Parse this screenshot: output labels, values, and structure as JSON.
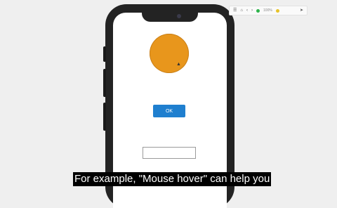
{
  "app": {
    "ok_button_label": "OK",
    "text_input_value": "",
    "text_input_placeholder": ""
  },
  "colors": {
    "circle": "#e8961c",
    "ok_button": "#1f7fcf",
    "phone_frame": "#232323"
  },
  "icons": {
    "cursor": "cursor-icon",
    "menu": "menu-icon",
    "home": "home-icon",
    "back": "back-icon",
    "forward": "forward-icon",
    "share": "send-icon"
  },
  "toolbar": {
    "zoom_label": "100%"
  },
  "subtitle": {
    "text": "For example, \"Mouse hover\" can help you"
  }
}
